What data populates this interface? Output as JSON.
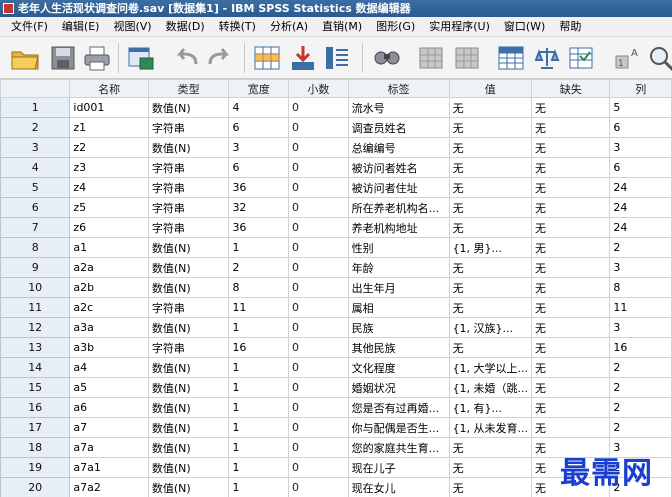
{
  "window": {
    "title": "老年人生活现状调查问卷.sav [数据集1] - IBM SPSS Statistics 数据编辑器"
  },
  "menu": [
    "文件(F)",
    "编辑(E)",
    "视图(V)",
    "数据(D)",
    "转换(T)",
    "分析(A)",
    "直销(M)",
    "图形(G)",
    "实用程序(U)",
    "窗口(W)",
    "帮助"
  ],
  "toolbar": {
    "buttons": [
      "open-folder-icon",
      "save-icon",
      "print-icon",
      "recall-dialog-icon",
      "undo-icon",
      "redo-icon",
      "goto-case-icon",
      "goto-variable-icon",
      "variables-icon",
      "find-icon",
      "insert-cases-icon",
      "insert-variable-icon",
      "split-file-icon",
      "weight-cases-icon",
      "select-cases-icon",
      "value-labels-icon"
    ]
  },
  "columns": [
    "",
    "名称",
    "类型",
    "宽度",
    "小数",
    "标签",
    "值",
    "缺失",
    "列"
  ],
  "rows": [
    [
      "1",
      "id001",
      "数值(N)",
      "4",
      "0",
      "流水号",
      "无",
      "无",
      "5"
    ],
    [
      "2",
      "z1",
      "字符串",
      "6",
      "0",
      "调查员姓名",
      "无",
      "无",
      "6"
    ],
    [
      "3",
      "z2",
      "数值(N)",
      "3",
      "0",
      "总编编号",
      "无",
      "无",
      "3"
    ],
    [
      "4",
      "z3",
      "字符串",
      "6",
      "0",
      "被访问者姓名",
      "无",
      "无",
      "6"
    ],
    [
      "5",
      "z4",
      "字符串",
      "36",
      "0",
      "被访问者住址",
      "无",
      "无",
      "24"
    ],
    [
      "6",
      "z5",
      "字符串",
      "32",
      "0",
      "所在养老机构名...",
      "无",
      "无",
      "24"
    ],
    [
      "7",
      "z6",
      "字符串",
      "36",
      "0",
      "养老机构地址",
      "无",
      "无",
      "24"
    ],
    [
      "8",
      "a1",
      "数值(N)",
      "1",
      "0",
      "性别",
      "{1, 男}...",
      "无",
      "2"
    ],
    [
      "9",
      "a2a",
      "数值(N)",
      "2",
      "0",
      "年龄",
      "无",
      "无",
      "3"
    ],
    [
      "10",
      "a2b",
      "数值(N)",
      "8",
      "0",
      "出生年月",
      "无",
      "无",
      "8"
    ],
    [
      "11",
      "a2c",
      "字符串",
      "11",
      "0",
      "属相",
      "无",
      "无",
      "11"
    ],
    [
      "12",
      "a3a",
      "数值(N)",
      "1",
      "0",
      "民族",
      "{1, 汉族}...",
      "无",
      "3"
    ],
    [
      "13",
      "a3b",
      "字符串",
      "16",
      "0",
      "其他民族",
      "无",
      "无",
      "16"
    ],
    [
      "14",
      "a4",
      "数值(N)",
      "1",
      "0",
      "文化程度",
      "{1, 大学以上...",
      "无",
      "2"
    ],
    [
      "15",
      "a5",
      "数值(N)",
      "1",
      "0",
      "婚姻状况",
      "{1, 未婚（跳...",
      "无",
      "2"
    ],
    [
      "16",
      "a6",
      "数值(N)",
      "1",
      "0",
      "您是否有过再婚...",
      "{1, 有}...",
      "无",
      "2"
    ],
    [
      "17",
      "a7",
      "数值(N)",
      "1",
      "0",
      "你与配偶是否生...",
      "{1, 从未发育...",
      "无",
      "2"
    ],
    [
      "18",
      "a7a",
      "数值(N)",
      "1",
      "0",
      "您的家庭共生育...",
      "无",
      "无",
      "3"
    ],
    [
      "19",
      "a7a1",
      "数值(N)",
      "1",
      "0",
      "现在儿子",
      "无",
      "无",
      "2"
    ],
    [
      "20",
      "a7a2",
      "数值(N)",
      "1",
      "0",
      "现在女儿",
      "无",
      "无",
      "2"
    ]
  ],
  "watermark": "最需网"
}
